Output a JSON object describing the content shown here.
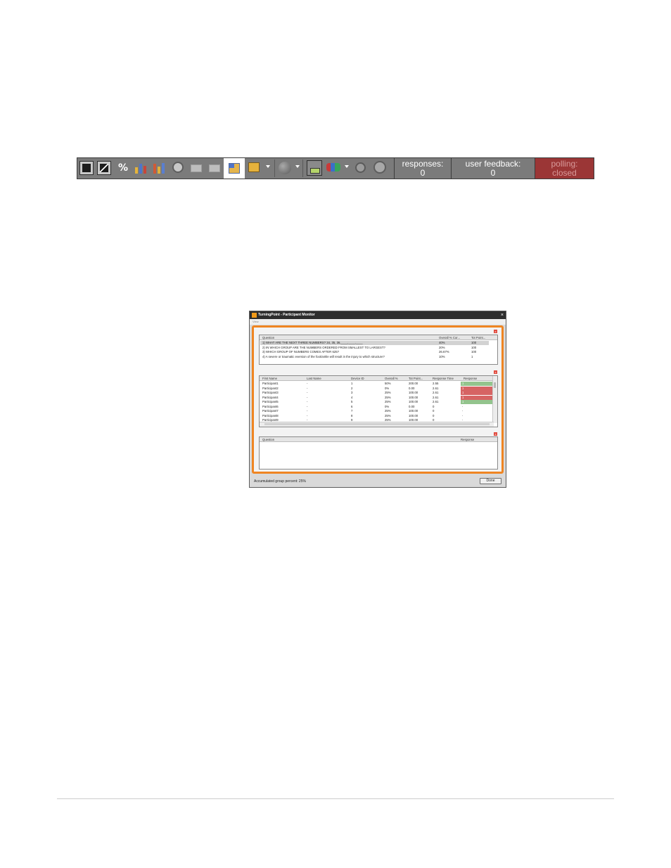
{
  "toolbar": {
    "icons": [
      "exit-icon",
      "expand-icon",
      "percent-icon",
      "bar-chart-icon",
      "column-chart-icon",
      "timer-icon",
      "envelope-icon",
      "envelope-icon",
      "participant-monitor-icon",
      "dropdown-icon",
      "ball-icon",
      "import-icon",
      "devices-icon",
      "settings-icon",
      "stop-icon"
    ],
    "percent_label": "%",
    "responses_label": "responses:",
    "responses_value": "0",
    "feedback_label": "user feedback:",
    "feedback_value": "0",
    "polling_label": "polling:",
    "polling_value": "closed",
    "colors": {
      "bar": "#7b7b7b",
      "polling_bg": "#9b3636"
    }
  },
  "monitor": {
    "title": "TurningPoint - Participant Monitor",
    "menu": "View",
    "close_glyph": "×",
    "remove_glyph": "x",
    "questions_table": {
      "headers": [
        "Question",
        "Overall % Cor...",
        "Tot Point..."
      ],
      "rows": [
        {
          "question": "1) WHAT ARE THE NEXT THREE NUMBERS? 34, 35, 36,____,____,____",
          "overall": "40%",
          "points": "100"
        },
        {
          "question": "2) IN WHICH GROUP ARE THE NUMBERS ORDERED FROM SMALLEST TO LARGEST?",
          "overall": "20%",
          "points": "100"
        },
        {
          "question": "3) WHICH GROUP OF NUMBERS COMES AFTER 625?",
          "overall": "26.67%",
          "points": "100"
        },
        {
          "question": "4) A severe or traumatic eversion of the foot/ankle will result in the injury to which structure?",
          "overall": "10%",
          "points": "1"
        }
      ]
    },
    "participants_table": {
      "headers": [
        "First Name",
        "Last Name",
        "Device ID",
        "Overall %",
        "Tot Point...",
        "Response Time",
        "Response"
      ],
      "rows": [
        {
          "first": "Participant1",
          "last": "-",
          "device": "1",
          "overall": "50%",
          "points": "200.00",
          "time": "2.55",
          "response": "1",
          "status": "correct"
        },
        {
          "first": "Participant2",
          "last": "-",
          "device": "2",
          "overall": "0%",
          "points": "0.00",
          "time": "2.61",
          "response": "1",
          "status": "incorrect"
        },
        {
          "first": "Participant3",
          "last": "-",
          "device": "3",
          "overall": "25%",
          "points": "100.00",
          "time": "2.61",
          "response": "1",
          "status": "incorrect"
        },
        {
          "first": "Participant4",
          "last": "-",
          "device": "4",
          "overall": "25%",
          "points": "100.00",
          "time": "2.61",
          "response": "1",
          "status": "incorrect"
        },
        {
          "first": "Participant5",
          "last": "-",
          "device": "5",
          "overall": "25%",
          "points": "100.00",
          "time": "2.61",
          "response": "1",
          "status": "correct"
        },
        {
          "first": "Participant6",
          "last": "-",
          "device": "6",
          "overall": "0%",
          "points": "0.00",
          "time": "0",
          "response": "-",
          "status": "none"
        },
        {
          "first": "Participant7",
          "last": "-",
          "device": "7",
          "overall": "25%",
          "points": "100.00",
          "time": "0",
          "response": "-",
          "status": "none"
        },
        {
          "first": "Participant8",
          "last": "-",
          "device": "8",
          "overall": "25%",
          "points": "100.00",
          "time": "0",
          "response": "-",
          "status": "none"
        },
        {
          "first": "Participant9",
          "last": "-",
          "device": "9",
          "overall": "25%",
          "points": "100.00",
          "time": "0",
          "response": "-",
          "status": "none"
        }
      ]
    },
    "detail_table": {
      "headers": [
        "Question",
        "Response"
      ]
    },
    "status_text": "Accumulated group percent: 25%",
    "done_label": "Done",
    "colors": {
      "frame": "#ef8522",
      "correct": "#93c48d",
      "incorrect": "#d66363"
    }
  }
}
